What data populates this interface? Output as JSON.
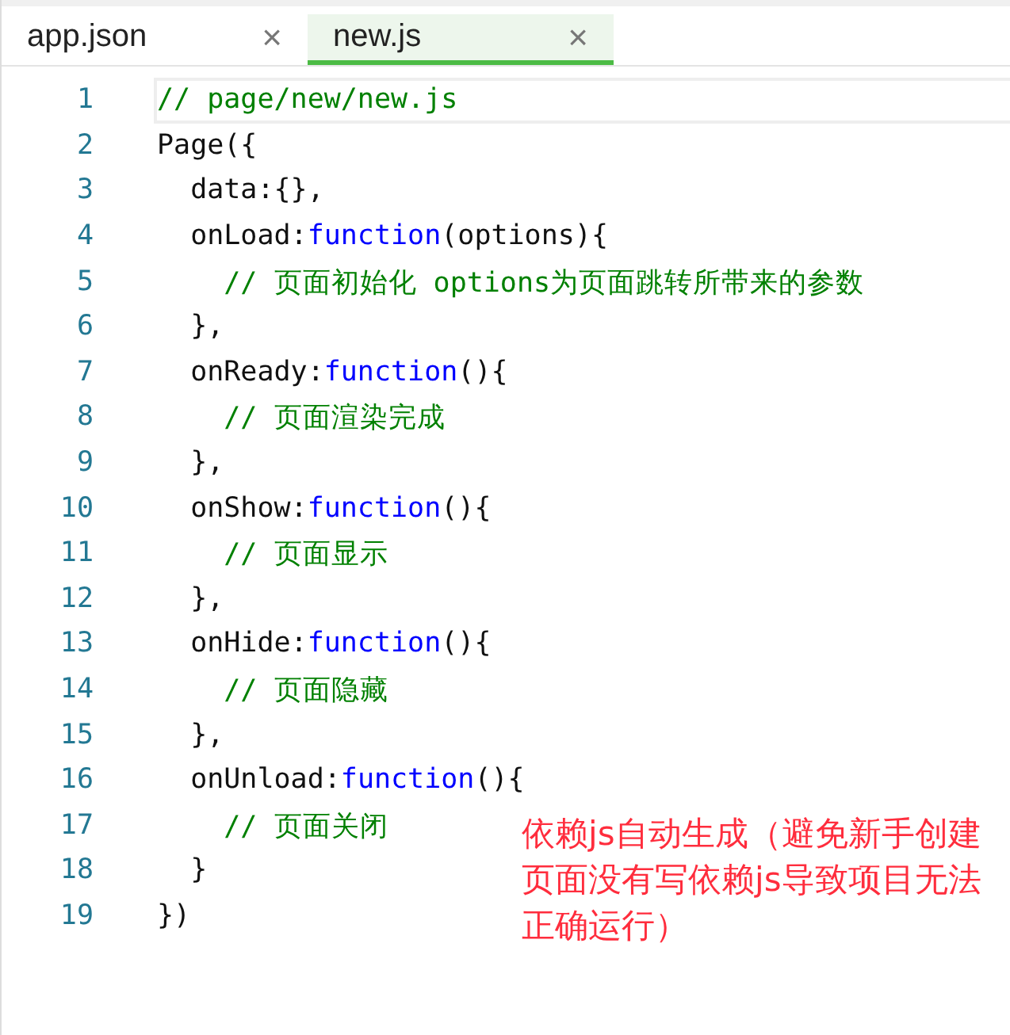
{
  "tabs": [
    {
      "label": "app.json",
      "close": "×",
      "selected": false
    },
    {
      "label": "new.js",
      "close": "×",
      "selected": true
    }
  ],
  "editor": {
    "lines": [
      {
        "number": "1",
        "current": true,
        "tokens": [
          {
            "kind": "comment",
            "text": "// page/new/new.js"
          }
        ]
      },
      {
        "number": "2",
        "current": false,
        "tokens": [
          {
            "kind": "plain",
            "text": "Page({"
          }
        ]
      },
      {
        "number": "3",
        "current": false,
        "tokens": [
          {
            "kind": "plain",
            "text": "  data:{},"
          }
        ]
      },
      {
        "number": "4",
        "current": false,
        "tokens": [
          {
            "kind": "plain",
            "text": "  onLoad:"
          },
          {
            "kind": "keyword",
            "text": "function"
          },
          {
            "kind": "plain",
            "text": "(options){"
          }
        ]
      },
      {
        "number": "5",
        "current": false,
        "tokens": [
          {
            "kind": "comment",
            "text": "    // 页面初始化 options为页面跳转所带来的参数"
          }
        ]
      },
      {
        "number": "6",
        "current": false,
        "tokens": [
          {
            "kind": "plain",
            "text": "  },"
          }
        ]
      },
      {
        "number": "7",
        "current": false,
        "tokens": [
          {
            "kind": "plain",
            "text": "  onReady:"
          },
          {
            "kind": "keyword",
            "text": "function"
          },
          {
            "kind": "plain",
            "text": "(){"
          }
        ]
      },
      {
        "number": "8",
        "current": false,
        "tokens": [
          {
            "kind": "comment",
            "text": "    // 页面渲染完成"
          }
        ]
      },
      {
        "number": "9",
        "current": false,
        "tokens": [
          {
            "kind": "plain",
            "text": "  },"
          }
        ]
      },
      {
        "number": "10",
        "current": false,
        "tokens": [
          {
            "kind": "plain",
            "text": "  onShow:"
          },
          {
            "kind": "keyword",
            "text": "function"
          },
          {
            "kind": "plain",
            "text": "(){"
          }
        ]
      },
      {
        "number": "11",
        "current": false,
        "tokens": [
          {
            "kind": "comment",
            "text": "    // 页面显示"
          }
        ]
      },
      {
        "number": "12",
        "current": false,
        "tokens": [
          {
            "kind": "plain",
            "text": "  },"
          }
        ]
      },
      {
        "number": "13",
        "current": false,
        "tokens": [
          {
            "kind": "plain",
            "text": "  onHide:"
          },
          {
            "kind": "keyword",
            "text": "function"
          },
          {
            "kind": "plain",
            "text": "(){"
          }
        ]
      },
      {
        "number": "14",
        "current": false,
        "tokens": [
          {
            "kind": "comment",
            "text": "    // 页面隐藏"
          }
        ]
      },
      {
        "number": "15",
        "current": false,
        "tokens": [
          {
            "kind": "plain",
            "text": "  },"
          }
        ]
      },
      {
        "number": "16",
        "current": false,
        "tokens": [
          {
            "kind": "plain",
            "text": "  onUnload:"
          },
          {
            "kind": "keyword",
            "text": "function"
          },
          {
            "kind": "plain",
            "text": "(){"
          }
        ]
      },
      {
        "number": "17",
        "current": false,
        "tokens": [
          {
            "kind": "comment",
            "text": "    // 页面关闭"
          }
        ]
      },
      {
        "number": "18",
        "current": false,
        "tokens": [
          {
            "kind": "plain",
            "text": "  }"
          }
        ]
      },
      {
        "number": "19",
        "current": false,
        "tokens": [
          {
            "kind": "plain",
            "text": "})"
          }
        ]
      }
    ]
  },
  "annotation": "依赖js自动生成（避免新手创建页面没有写依赖js导致项目无法正确运行）"
}
